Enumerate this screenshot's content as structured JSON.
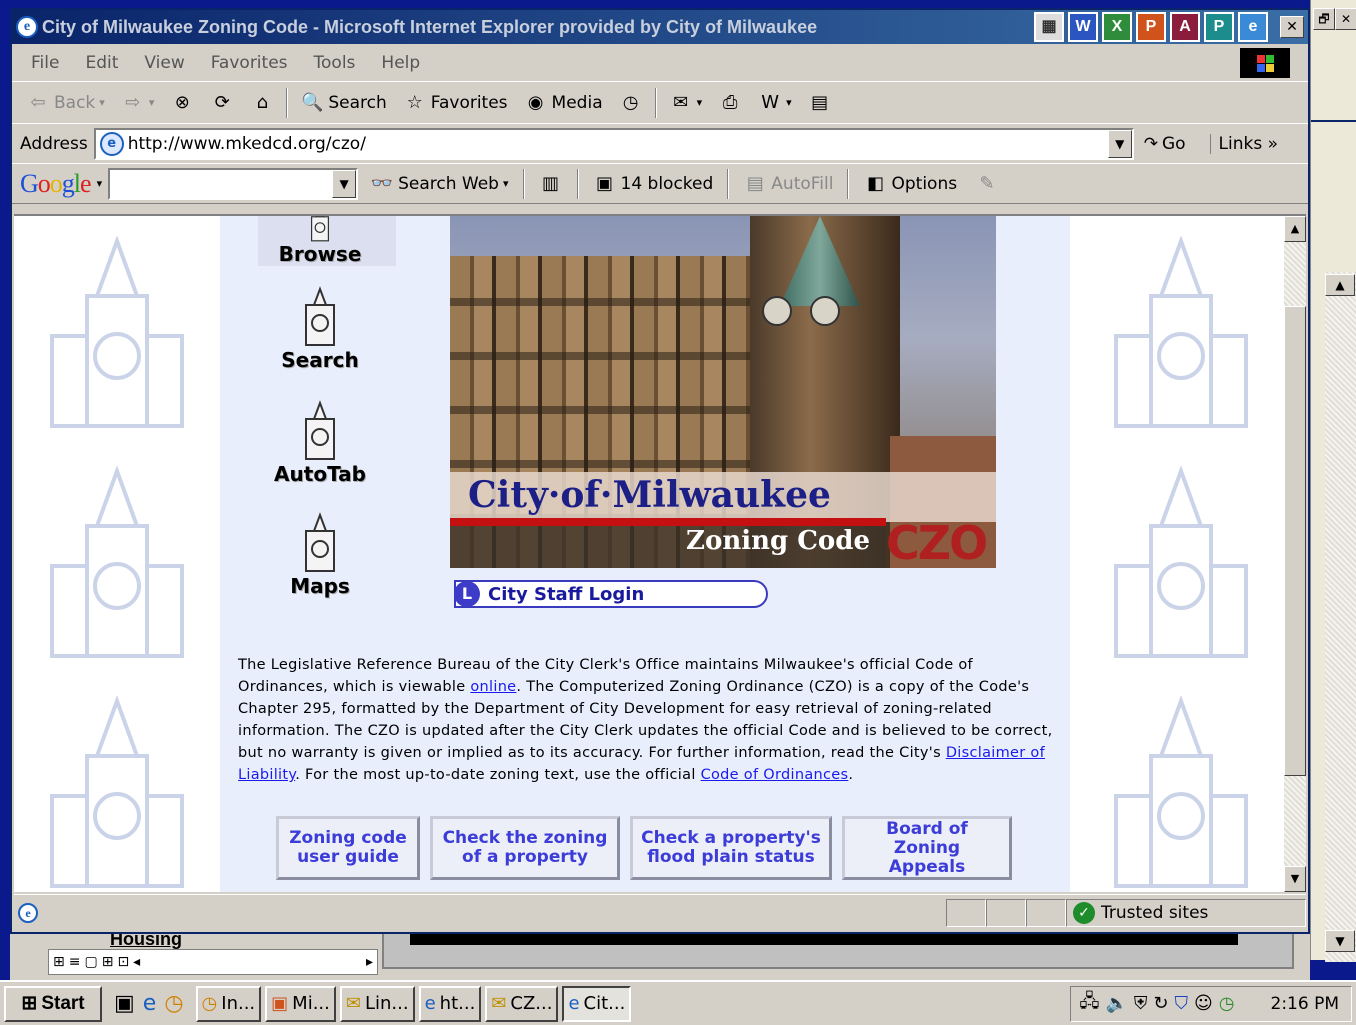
{
  "window": {
    "title": "City of Milwaukee Zoning Code - Microsoft Internet Explorer provided by City of Milwaukee"
  },
  "menu": [
    "File",
    "Edit",
    "View",
    "Favorites",
    "Tools",
    "Help"
  ],
  "toolbar": {
    "back": "Back",
    "search": "Search",
    "favorites": "Favorites",
    "media": "Media"
  },
  "address": {
    "label": "Address",
    "url": "http://www.mkedcd.org/czo/",
    "go": "Go",
    "links": "Links"
  },
  "google": {
    "logo": "Google",
    "search_web": "Search Web",
    "blocked": "14 blocked",
    "autofill": "AutoFill",
    "options": "Options"
  },
  "nav": [
    {
      "label": "Browse"
    },
    {
      "label": "Search"
    },
    {
      "label": "AutoTab"
    },
    {
      "label": "Maps"
    }
  ],
  "hero": {
    "title": "City·of·Milwaukee",
    "subtitle": "Zoning Code",
    "badge": "CZO"
  },
  "login": {
    "icon": "L",
    "label": "City Staff Login"
  },
  "paragraph": {
    "p1": "The Legislative Reference Bureau of the City Clerk's Office maintains Milwaukee's official Code of Ordinances, which is viewable ",
    "link_online": "online",
    "p2": ". The Computerized Zoning Ordinance (CZO) is a copy of the Code's Chapter 295, formatted by the Department of City Development for easy retrieval of zoning-related information. The CZO is updated after the City Clerk updates the official Code and is believed to be correct, but no warranty is given or implied as to its accuracy. For further information, read the City's ",
    "link_disclaimer": "Disclaimer of Liability",
    "p3": ".  For the most up-to-date zoning text, use the official ",
    "link_code": "Code of Ordinances",
    "p4": "."
  },
  "buttons": [
    {
      "line1": "Zoning code",
      "line2": "user guide"
    },
    {
      "line1": "Check the zoning",
      "line2": "of a property"
    },
    {
      "line1": "Check a property's",
      "line2": "flood plain status"
    },
    {
      "line1": "Board of",
      "line2": "Zoning Appeals"
    }
  ],
  "status": {
    "zone": "Trusted sites"
  },
  "background": {
    "housing": "Housing"
  },
  "taskbar": {
    "start": "Start",
    "tasks": [
      "In...",
      "Mi...",
      "Lin...",
      "ht...",
      "CZ...",
      "Cit..."
    ],
    "clock": "2:16 PM"
  }
}
